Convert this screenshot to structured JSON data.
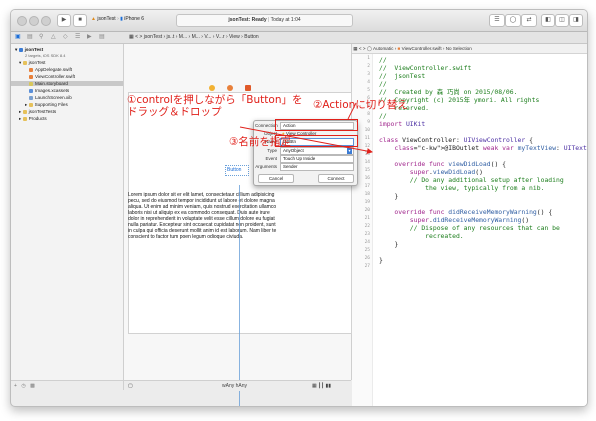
{
  "toolbar": {
    "scheme": "jsonTest",
    "device": "iPhone 6",
    "status": "jsonTest: Ready",
    "time": "Today at 1:04"
  },
  "jump_bar": {
    "left": [
      "jsonTest",
      "js..t",
      "M...",
      "M...",
      "V...",
      "V...r",
      "View",
      "Button"
    ],
    "right": [
      "Automatic",
      "ViewController.swift",
      "No Selection"
    ]
  },
  "navigator": {
    "items": [
      {
        "label": "jsonTest",
        "level": 0,
        "bold": true
      },
      {
        "label": "2 targets, iOS SDK 8.4",
        "level": 0,
        "small": true
      },
      {
        "label": "jsonTest",
        "level": 1
      },
      {
        "label": "AppDelegate.swift",
        "level": 2
      },
      {
        "label": "ViewController.swift",
        "level": 2
      },
      {
        "label": "Main.storyboard",
        "level": 2,
        "selected": true
      },
      {
        "label": "Images.xcassets",
        "level": 2
      },
      {
        "label": "LaunchScreen.xib",
        "level": 2
      },
      {
        "label": "Supporting Files",
        "level": 2
      },
      {
        "label": "jsonTestTests",
        "level": 1
      },
      {
        "label": "Products",
        "level": 1
      }
    ]
  },
  "canvas": {
    "button_label": "Button",
    "lorem": "Lorem ipsum dolor sit er elit lamet, consectetaur cillium adipisicing pecu, sed do eiusmod tempor incididunt ut labore et dolore magna aliqua. Ut enim ad minim veniam, quis nostrud exercitation ullamco laboris nisi ut aliquip ex ea commodo consequat. Duis aute irure dolor in reprehenderit in voluptate velit esse cillum dolore eu fugiat nulla pariatur. Excepteur sint occaecat cupidatat non proident, sunt in culpa qui officia deserunt mollit anim id est laborum. Nam liber te conscient to factor tum poen legum odioque civiuda.",
    "size_class": "wAny hAny"
  },
  "popup": {
    "connection_label": "Connection",
    "connection_value": "Action",
    "object_label": "Object",
    "object_value": "View Controller",
    "name_label": "Name",
    "name_value": "tapBtn",
    "type_label": "Type",
    "type_value": "AnyObject",
    "event_label": "Event",
    "event_value": "Touch Up Inside",
    "arguments_label": "Arguments",
    "arguments_value": "Sender",
    "cancel": "Cancel",
    "connect": "Connect"
  },
  "annotations": {
    "step1_line1": "①controlを押しながら「Button」を",
    "step1_line2": "ドラッグ＆ドロップ",
    "step2": "②Actionに切り替え",
    "step3": "③名前を指定"
  },
  "annotation_color": "#e0201a",
  "code": {
    "line_numbers": [
      "1",
      "2",
      "3",
      "4",
      "5",
      "6",
      "7",
      "8",
      "9",
      "10",
      "11",
      "12",
      "13",
      "14",
      "15",
      "16",
      "17",
      "18",
      "19",
      "20",
      "21",
      "22",
      "23",
      "24",
      "25",
      "26",
      "27"
    ],
    "lines": [
      "//",
      "//  ViewController.swift",
      "//  jsonTest",
      "//",
      "//  Created by 森 巧尚 on 2015/08/06.",
      "//  Copyright (c) 2015年 ymori. All rights",
      "    reserved.",
      "//",
      "import UIKit",
      "",
      "class ViewController: UIViewController {",
      "    @IBOutlet weak var myTextView: UITextView!",
      "",
      "    override func viewDidLoad() {",
      "        super.viewDidLoad()",
      "        // Do any additional setup after loading",
      "            the view, typically from a nib.",
      "    }",
      "",
      "    override func didReceiveMemoryWarning() {",
      "        super.didReceiveMemoryWarning()",
      "        // Dispose of any resources that can be",
      "            recreated.",
      "    }",
      "",
      "}"
    ]
  }
}
